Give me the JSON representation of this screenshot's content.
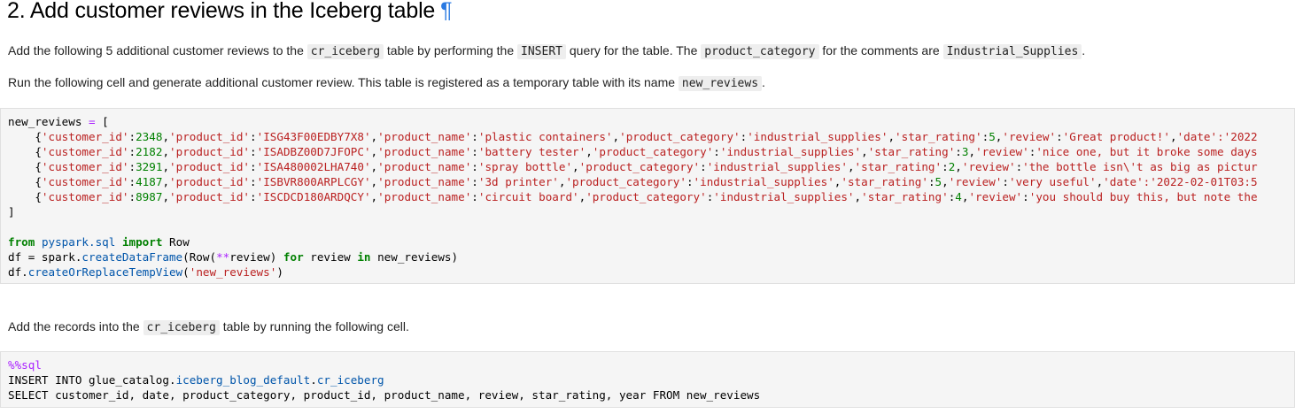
{
  "heading": {
    "title": "2. Add customer reviews in the Iceberg table",
    "anchor": "¶"
  },
  "intro1": {
    "part1": "Add the following 5 additional customer reviews to the ",
    "code1": "cr_iceberg",
    "part2": " table by performing the ",
    "code2": "INSERT",
    "part3": " query for the table. The ",
    "code3": "product_category",
    "part4": " for the comments are ",
    "code4": "Industrial_Supplies",
    "part5": "."
  },
  "intro2": {
    "part1": "Run the following cell and generate additional customer review. This table is registered as a temporary table with its name ",
    "code1": "new_reviews",
    "part2": "."
  },
  "python_cell": {
    "var": "new_reviews",
    "rows": [
      {
        "customer_id": "2348",
        "product_id": "'ISG43F00EDBY7X8'",
        "product_name": "'plastic containers'",
        "product_category": "'industrial_supplies'",
        "star_rating": "5",
        "review_value": "'Great product!'",
        "tail_key": "'date'",
        "tail": ":'2022"
      },
      {
        "customer_id": "2182",
        "product_id": "'ISADBZ00D7JFOPC'",
        "product_name": "'battery tester'",
        "product_category": "'industrial_supplies'",
        "star_rating": "3",
        "review_value": "'nice one, but it broke some days",
        "tail_key": "",
        "tail": ""
      },
      {
        "customer_id": "3291",
        "product_id": "'ISA480002LHA740'",
        "product_name": "'spray bottle'",
        "product_category": "'industrial_supplies'",
        "star_rating": "2",
        "review_value": "'the bottle isn\\'t as big as pictur",
        "tail_key": "",
        "tail": ""
      },
      {
        "customer_id": "4187",
        "product_id": "'ISBVR800ARPLCGY'",
        "product_name": "'3d printer'",
        "product_category": "'industrial_supplies'",
        "star_rating": "5",
        "review_value": "'very useful'",
        "tail_key": "'date'",
        "tail": ":'2022-02-01T03:5"
      },
      {
        "customer_id": "8987",
        "product_id": "'ISCDCD180ARDQCY'",
        "product_name": "'circuit board'",
        "product_category": "'industrial_supplies'",
        "star_rating": "4",
        "review_value": "'you should buy this, but note the",
        "tail_key": "",
        "tail": ""
      }
    ],
    "import_from": "from",
    "import_module": "pyspark.sql",
    "import_kw": "import",
    "import_name": "Row",
    "df_line_prefix": "df = spark.",
    "df_method": "createDataFrame",
    "df_args_a": "(Row(",
    "df_splat": "**",
    "df_args_b": "review) ",
    "df_for": "for",
    "df_args_c": " review ",
    "df_in": "in",
    "df_args_d": " new_reviews)",
    "view_prefix": "df.",
    "view_method": "createOrReplaceTempView",
    "view_arg": "'new_reviews'"
  },
  "intro3": {
    "part1": "Add the records into the ",
    "code1": "cr_iceberg",
    "part2": " table by running the following cell."
  },
  "sql_cell": {
    "magic": "%%sql",
    "insert_prefix": "INSERT INTO glue_catalog.",
    "insert_db": "iceberg_blog_default",
    "insert_dot": ".",
    "insert_table": "cr_iceberg",
    "select_line": "SELECT customer_id, date, product_category, product_id, product_name, review, star_rating, year FROM new_reviews"
  }
}
